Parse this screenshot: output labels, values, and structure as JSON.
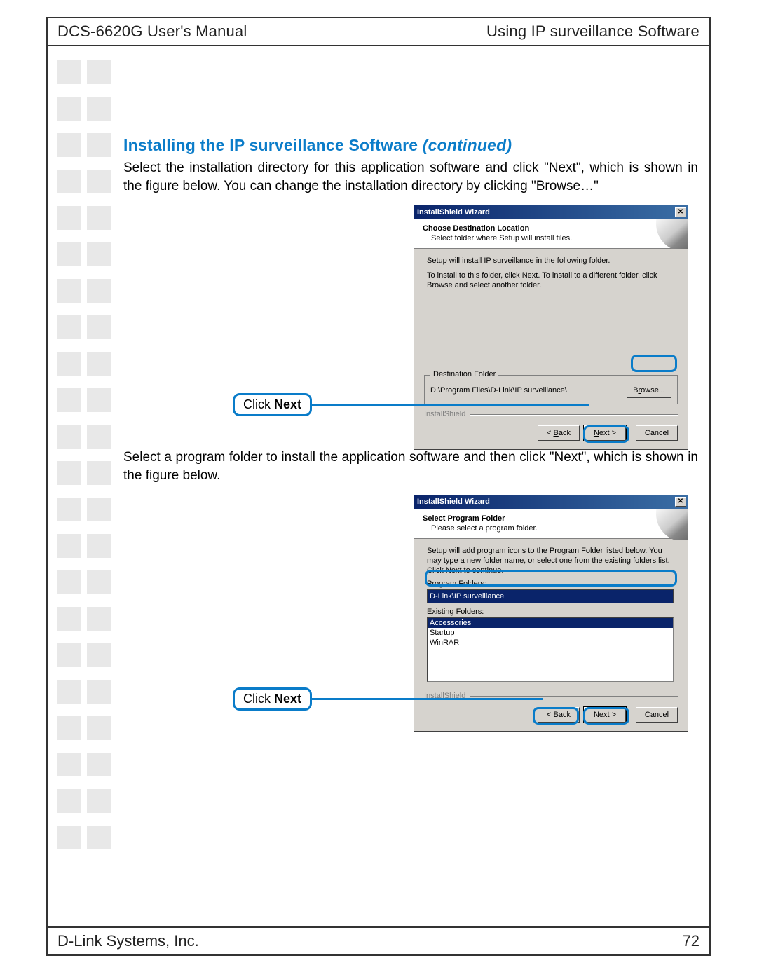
{
  "header": {
    "left": "DCS-6620G User's Manual",
    "right": "Using IP surveillance Software"
  },
  "footer": {
    "left": "D-Link Systems, Inc.",
    "page": "72"
  },
  "section": {
    "title_main": "Installing the IP surveillance Software ",
    "title_ital": "(continued)",
    "para1": "Select the installation directory for this application software and click \"Next\", which is shown in the figure below. You can change the installation directory by clicking \"Browse…\"",
    "para2": "Select a program folder to install the application software and then click \"Next\", which is shown in the figure below."
  },
  "callout": {
    "click": "Click ",
    "next": "Next"
  },
  "wizard1": {
    "title": "InstallShield Wizard",
    "header_title": "Choose Destination Location",
    "header_sub": "Select folder where Setup will install files.",
    "body_line1": "Setup will install IP surveillance in the following folder.",
    "body_line2": "To install to this folder, click Next. To install to a different folder, click Browse and select another folder.",
    "dest_legend": "Destination Folder",
    "dest_path": "D:\\Program Files\\D-Link\\IP surveillance\\",
    "browse_pre": "B",
    "browse_u": "r",
    "browse_post": "owse...",
    "divider": "InstallShield",
    "back_lt": "< ",
    "back_u": "B",
    "back_post": "ack",
    "next_u": "N",
    "next_post": "ext >",
    "cancel": "Cancel"
  },
  "wizard2": {
    "title": "InstallShield Wizard",
    "header_title": "Select Program Folder",
    "header_sub": "Please select a program folder.",
    "body_line1": "Setup will add program icons to the Program Folder listed below.  You may type a new folder name, or select one from the existing folders list.  Click Next to continue.",
    "pf_label_pre": "",
    "pf_label_u": "P",
    "pf_label_post": "rogram Folders:",
    "pf_value": "D-Link\\IP surveillance",
    "ef_label_pre": "E",
    "ef_label_u": "x",
    "ef_label_post": "isting Folders:",
    "ef_items": [
      "Accessories",
      "Startup",
      "WinRAR"
    ],
    "divider": "InstallShield",
    "back_lt": "< ",
    "back_u": "B",
    "back_post": "ack",
    "next_u": "N",
    "next_post": "ext >",
    "cancel": "Cancel"
  }
}
